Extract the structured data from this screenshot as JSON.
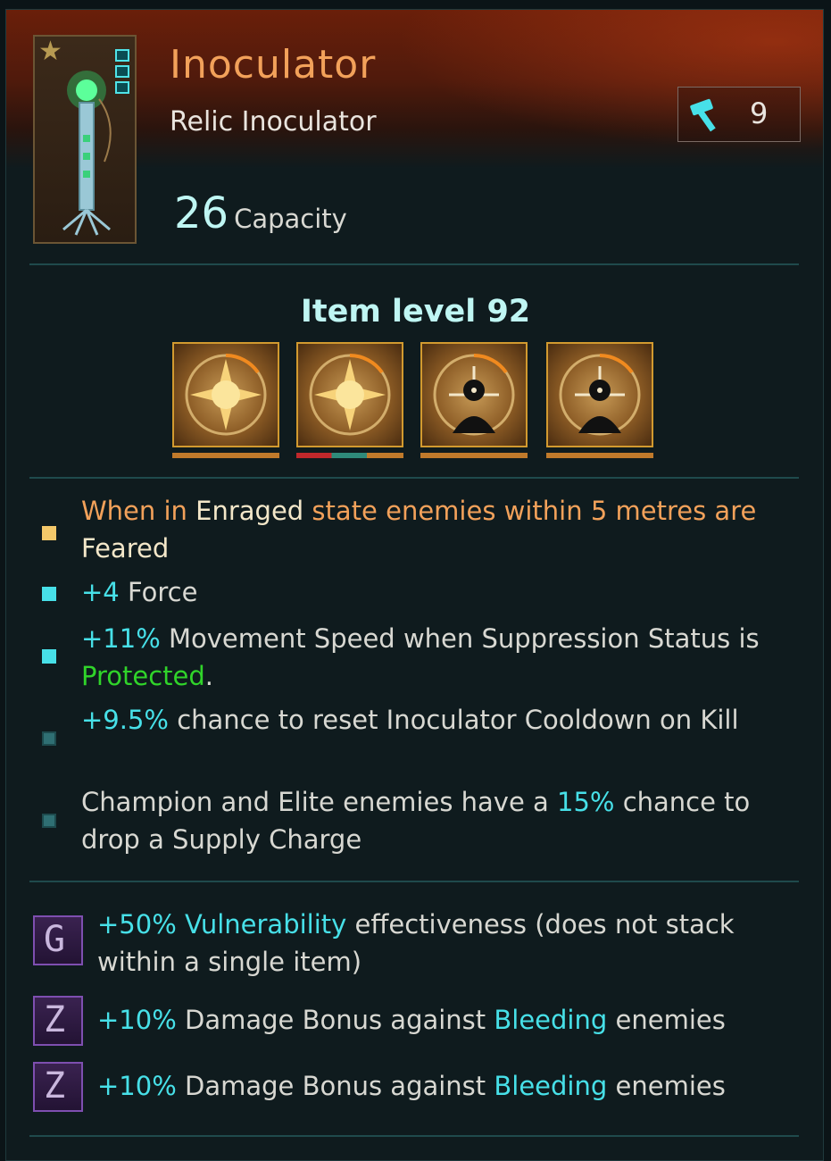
{
  "item": {
    "name": "Inoculator",
    "type": "Relic Inoculator",
    "durability": "9",
    "capacity_value": "26",
    "capacity_label": "Capacity",
    "item_level": "Item level 92"
  },
  "mods": [
    {
      "icon": "sun-burst-icon",
      "bar": "orange"
    },
    {
      "icon": "sun-burst-icon",
      "bar": "red-teal-orange"
    },
    {
      "icon": "target-silhouette-icon",
      "bar": "orange"
    },
    {
      "icon": "target-silhouette-icon",
      "bar": "orange"
    }
  ],
  "traits": [
    {
      "bullet_color": "#f3c86a",
      "parts": [
        {
          "t": "When in ",
          "c": "orange"
        },
        {
          "t": "Enraged",
          "c": "cream"
        },
        {
          "t": " state enemies within 5 metres are ",
          "c": "orange"
        },
        {
          "t": "Feared",
          "c": "cream"
        }
      ]
    },
    {
      "bullet_color": "#47e0e8",
      "parts": [
        {
          "t": "+4",
          "c": "cyan"
        },
        {
          "t": " Force",
          "c": "grey"
        }
      ]
    },
    {
      "bullet_color": "#47e0e8",
      "parts": [
        {
          "t": "+11%",
          "c": "cyan"
        },
        {
          "t": " Movement Speed when Suppression Status is ",
          "c": "grey"
        },
        {
          "t": "Protected",
          "c": "green"
        },
        {
          "t": ".",
          "c": "grey"
        }
      ]
    },
    {
      "bullet_color": "#2f6f73",
      "parts": [
        {
          "t": "+9.5%",
          "c": "cyan"
        },
        {
          "t": " chance to reset Inoculator Cooldown on Kill",
          "c": "grey"
        }
      ]
    },
    {
      "bullet_color": "#2f6f73",
      "parts": [
        {
          "t": "Champion and Elite enemies have a ",
          "c": "grey"
        },
        {
          "t": "15%",
          "c": "cyan"
        },
        {
          "t": " chance to drop a Supply Charge",
          "c": "grey"
        }
      ]
    }
  ],
  "runes": [
    {
      "glyph": "G",
      "parts": [
        {
          "t": "+50% ",
          "c": "cyan"
        },
        {
          "t": "Vulnerability",
          "c": "cyan"
        },
        {
          "t": " effectiveness (does not stack within a single item)",
          "c": "grey"
        }
      ]
    },
    {
      "glyph": "Z",
      "parts": [
        {
          "t": "+10%",
          "c": "cyan"
        },
        {
          "t": " Damage Bonus against ",
          "c": "grey"
        },
        {
          "t": "Bleeding",
          "c": "cyan"
        },
        {
          "t": " enemies",
          "c": "grey"
        }
      ]
    },
    {
      "glyph": "Z",
      "parts": [
        {
          "t": "+10%",
          "c": "cyan"
        },
        {
          "t": " Damage Bonus against ",
          "c": "grey"
        },
        {
          "t": "Bleeding",
          "c": "cyan"
        },
        {
          "t": " enemies",
          "c": "grey"
        }
      ]
    }
  ],
  "colors": {
    "name": "#f2a15a",
    "accent_cyan": "#47e0e8",
    "protected_green": "#30d42a",
    "mod_border": "#d29a2f"
  }
}
